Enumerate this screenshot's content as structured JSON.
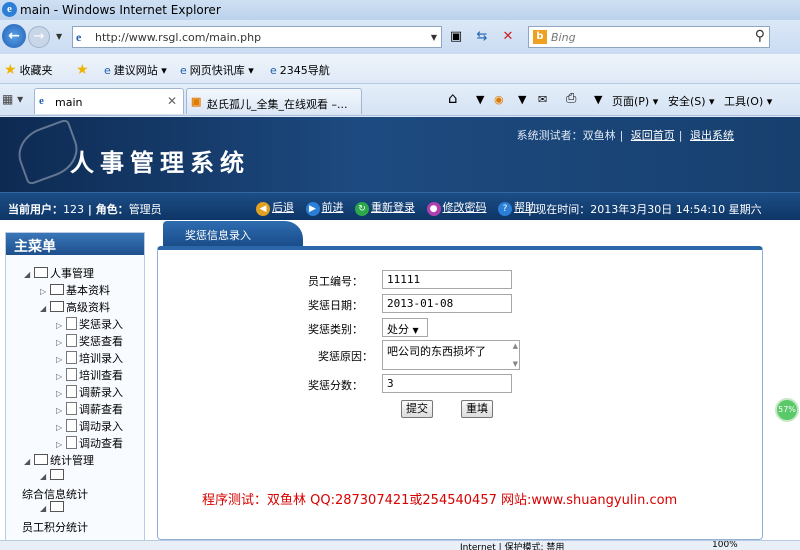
{
  "window": {
    "title": "main - Windows Internet Explorer"
  },
  "address_bar": {
    "url": "http://www.rsgl.com/main.php",
    "search_placeholder": "Bing"
  },
  "favorites_bar": {
    "favorites": "收藏夹",
    "items": [
      "建议网站 ▾",
      "网页快讯库 ▾",
      "2345导航"
    ]
  },
  "tabs": [
    {
      "label": "main",
      "active": true
    },
    {
      "label": "赵氏孤儿_全集_在线观看 –...",
      "active": false
    }
  ],
  "commands": [
    "页面(P) ▾",
    "安全(S) ▾",
    "工具(O) ▾"
  ],
  "header": {
    "system_title": "人事管理系统",
    "tester_label": "系统测试者：双鱼林",
    "home_link": "返回首页",
    "logout_link": "退出系统"
  },
  "info_bar": {
    "current_user_label": "当前用户：",
    "user_id": "123",
    "role_label": "角色：",
    "role": "管理员",
    "actions": [
      "后退",
      "前进",
      "重新登录",
      "修改密码",
      "帮助"
    ],
    "time_label": "现在时间：",
    "time": "2013年3月30日 14:54:10 星期六"
  },
  "sidebar": {
    "title": "主菜单",
    "items": [
      "人事管理",
      "基本资料",
      "高级资料",
      "奖惩录入",
      "奖惩查看",
      "培训录入",
      "培训查看",
      "调薪录入",
      "调薪查看",
      "调动录入",
      "调动查看",
      "统计管理",
      "",
      "综合信息统计",
      "",
      "员工积分统计"
    ]
  },
  "content_tab": "奖惩信息录入",
  "form": {
    "employee_id_label": "员工编号：",
    "employee_id": "11111",
    "date_label": "奖惩日期：",
    "date": "2013-01-08",
    "type_label": "奖惩类别：",
    "type": "处分",
    "reason_label": "奖惩原因：",
    "reason": "吧公司的东西损坏了",
    "score_label": "奖惩分数：",
    "score": "3",
    "submit": "提交",
    "reset": "重填"
  },
  "footer_note": "程序测试：双鱼林 QQ:287307421或254540457 网站:www.shuangyulin.com",
  "status": {
    "zone": "Internet | 保护模式: 禁用",
    "zoom": "100%",
    "indicator": "57%"
  },
  "colors": {
    "banner": "#17406f",
    "accent": "#2a66a8",
    "footer_text": "#d80000"
  }
}
